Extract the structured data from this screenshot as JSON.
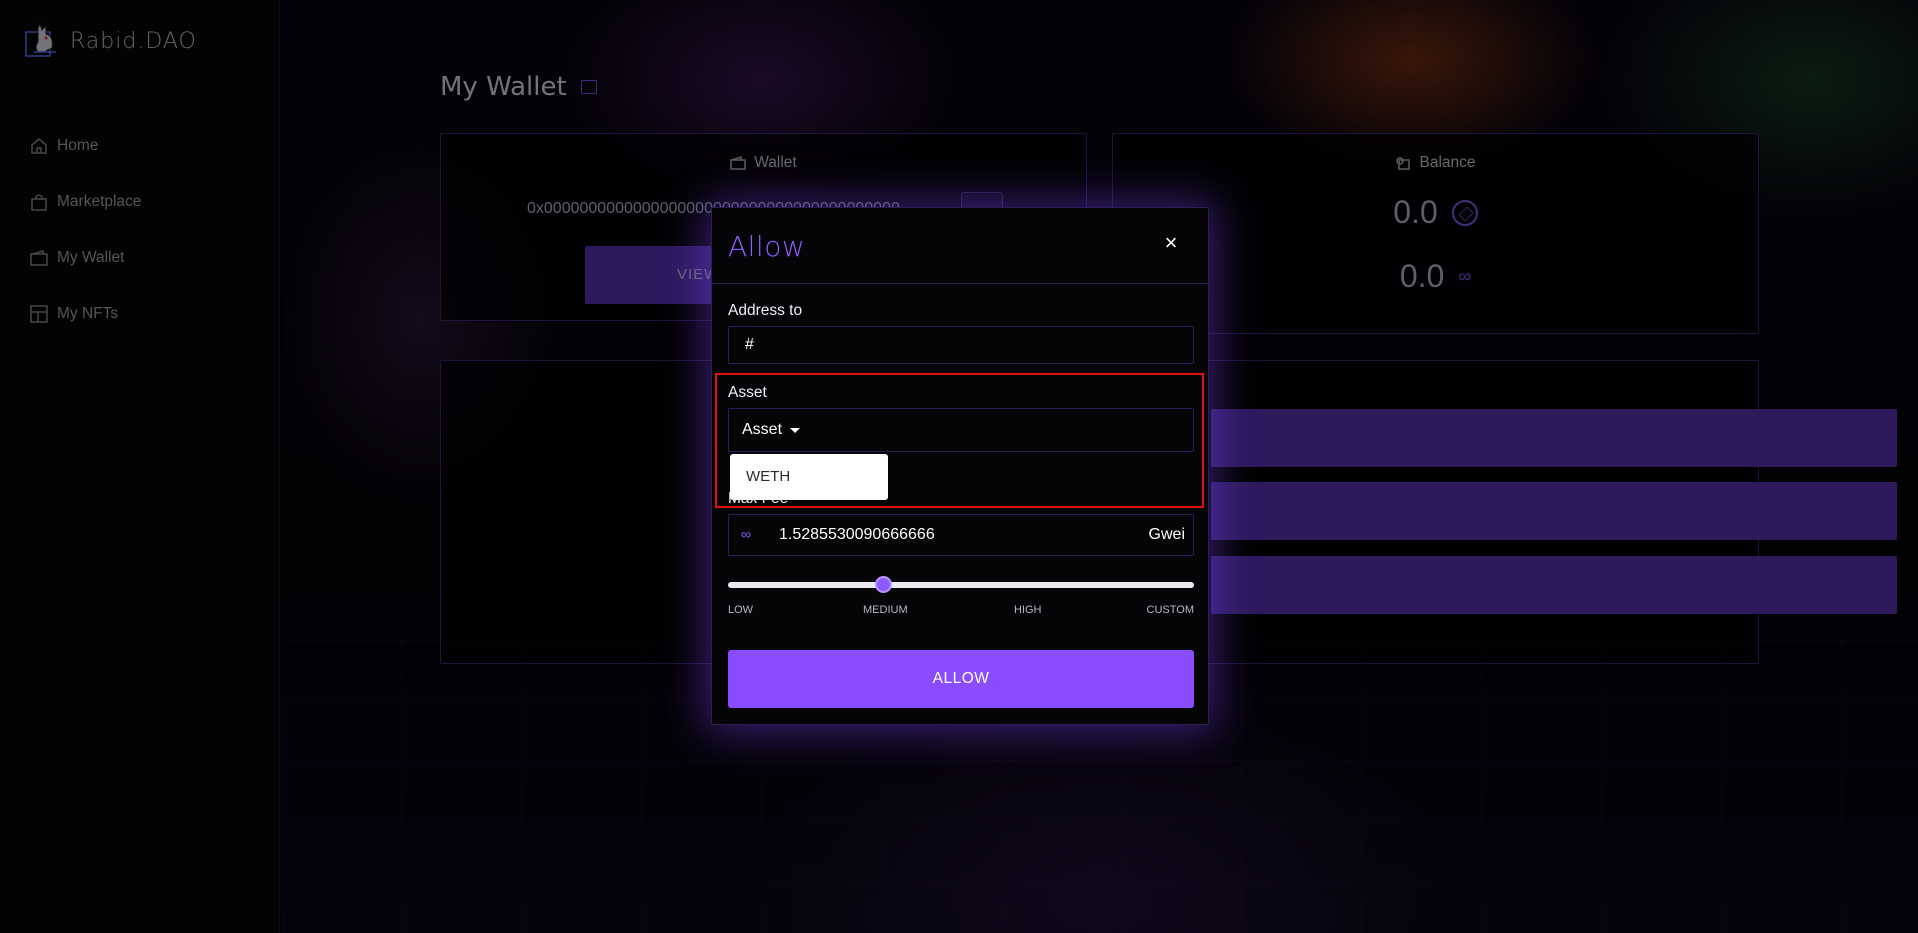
{
  "app": {
    "logo_text": "Rabid.DAO"
  },
  "sidebar": {
    "items": [
      {
        "label": "Home",
        "icon": "home-icon"
      },
      {
        "label": "Marketplace",
        "icon": "bag-icon"
      },
      {
        "label": "My Wallet",
        "icon": "wallet-icon"
      },
      {
        "label": "My NFTs",
        "icon": "grid-icon"
      }
    ]
  },
  "page": {
    "title": "My Wallet"
  },
  "wallet_card": {
    "title": "Wallet",
    "address": "0x0000000000000000000000000000000000000000",
    "view_button": "VIEW"
  },
  "balance_card": {
    "title": "Balance",
    "eth_balance": "0.0",
    "link_balance": "0.0"
  },
  "modal": {
    "title": "Allow",
    "close_symbol": "×",
    "address_label": "Address to",
    "address_value": "#",
    "asset_label": "Asset",
    "asset_toggle": "Asset",
    "asset_options": [
      "WETH"
    ],
    "max_fee_label": "Max Fee",
    "max_fee_value": "1.5285530090666666",
    "max_fee_unit": "Gwei",
    "slider_labels": [
      "LOW",
      "MEDIUM",
      "HIGH",
      "CUSTOM"
    ],
    "slider_level": "MEDIUM",
    "submit_label": "ALLOW"
  },
  "colors": {
    "accent": "#8a4cff",
    "highlight": "#e01010"
  }
}
